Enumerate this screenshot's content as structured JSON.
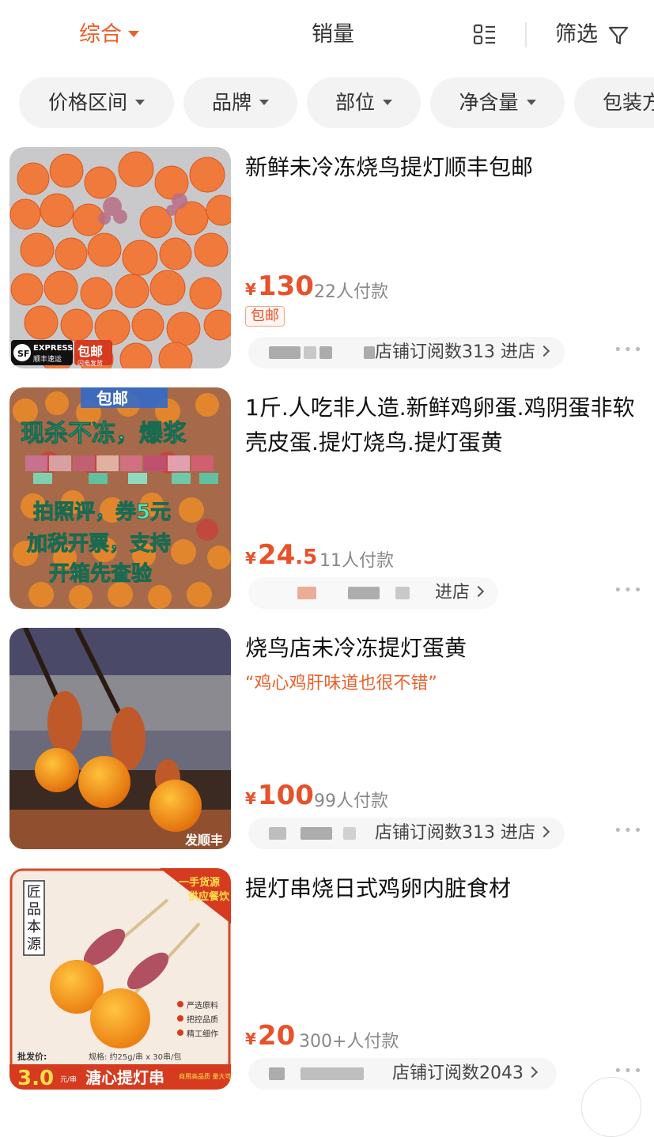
{
  "sort_bar": {
    "comprehensive": "综合",
    "sales": "销量",
    "filter": "筛选"
  },
  "filter_chips": [
    "价格区间",
    "品牌",
    "部位",
    "净含量",
    "包装方"
  ],
  "products": [
    {
      "title": "新鲜未冷冻烧鸟提灯顺丰包邮",
      "price_currency": "¥",
      "price_int": "130",
      "price_dec": "",
      "sales": "22人付款",
      "badge": "包邮",
      "shop_text": "店铺订阅数313 进店",
      "more": "•••",
      "thumb_text": {
        "express": "EXPRESS",
        "sf": "顺丰速运",
        "mail": "包邮",
        "flash": "闪电发货"
      }
    },
    {
      "title": "1斤.人吃非人造.新鲜鸡卵蛋.鸡阴蛋非软壳皮蛋.提灯烧鸟.提灯蛋黄",
      "price_currency": "¥",
      "price_int": "24",
      "price_dec": ".5",
      "sales": "11人付款",
      "shop_text": "进店",
      "more": "•••",
      "thumb_text": {
        "line0": "包邮",
        "line1": "现杀不冻，爆浆",
        "line3": "拍照评，券5元",
        "line4": "加税开票，支持",
        "line5": "开箱先查验"
      }
    },
    {
      "title": "烧鸟店未冷冻提灯蛋黄",
      "subline": "“鸡心鸡肝味道也很不错”",
      "price_currency": "¥",
      "price_int": "100",
      "price_dec": "",
      "sales": "99人付款",
      "shop_text": "店铺订阅数313 进店",
      "more": "•••",
      "thumb_text": {
        "corner": "发顺丰"
      }
    },
    {
      "title": "提灯串烧日式鸡卵内脏食材",
      "price_currency": "¥",
      "price_int": "20",
      "price_dec": "",
      "sales": "300+人付款",
      "shop_text": "店铺订阅数2043",
      "more": "•••",
      "thumb_text": {
        "brand": [
          "匠",
          "品",
          "本",
          "源"
        ],
        "ribbon1": "一手货源",
        "ribbon2": "供应餐饮",
        "feat1": "严选原料",
        "feat2": "把控品质",
        "feat3": "精工细作",
        "wholesale": "批发价:",
        "wprice": "3.0",
        "wunit": "元/串",
        "spec": "规格: 约25g/串 x 30串/包",
        "name": "溏心提灯串",
        "commercial": "商用高品质 量大可定制"
      }
    }
  ],
  "colors": {
    "accent": "#e8612c",
    "price": "#e8512a",
    "chip_bg": "#f3f3f3"
  },
  "icons": [
    "chevron-down-icon",
    "list-layout-icon",
    "filter-funnel-icon",
    "chevron-right-icon",
    "more-dots-icon"
  ]
}
